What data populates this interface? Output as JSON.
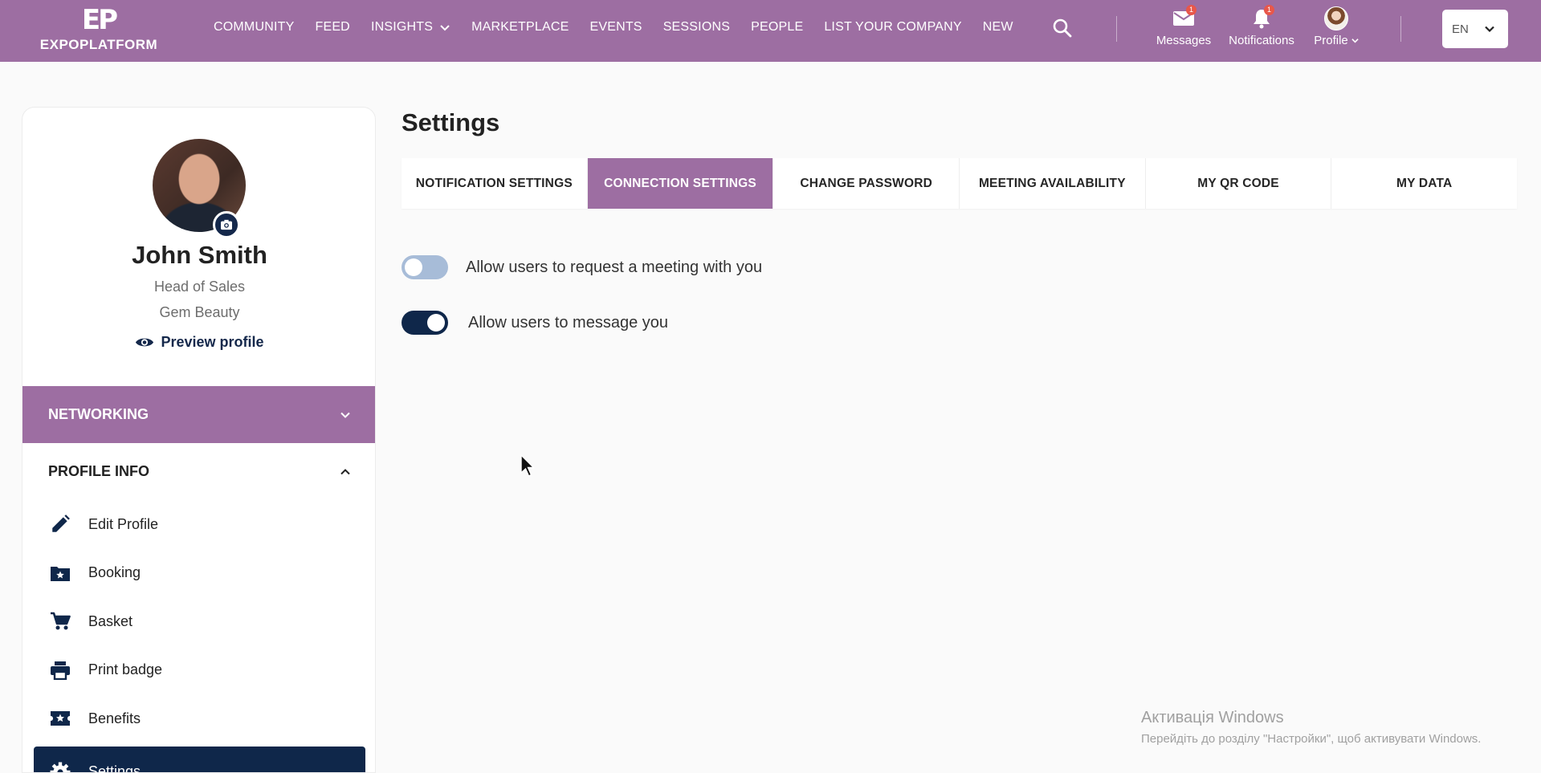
{
  "brand": {
    "mark": "EP",
    "name": "EXPOPLATFORM"
  },
  "nav": [
    {
      "label": "COMMUNITY"
    },
    {
      "label": "FEED"
    },
    {
      "label": "INSIGHTS",
      "has_dropdown": true
    },
    {
      "label": "MARKETPLACE"
    },
    {
      "label": "EVENTS"
    },
    {
      "label": "SESSIONS"
    },
    {
      "label": "PEOPLE"
    },
    {
      "label": "LIST YOUR COMPANY"
    },
    {
      "label": "NEW"
    }
  ],
  "top_actions": {
    "messages": {
      "label": "Messages",
      "badge": "1",
      "icon": "mail-icon"
    },
    "notifications": {
      "label": "Notifications",
      "badge": "1",
      "icon": "bell-icon"
    },
    "profile": {
      "label": "Profile",
      "icon": "avatar"
    }
  },
  "language": {
    "selected": "EN"
  },
  "profile": {
    "name": "John Smith",
    "role": "Head of Sales",
    "company": "Gem Beauty",
    "preview_label": "Preview profile"
  },
  "sidebar": {
    "networking_label": "NETWORKING",
    "profile_info_label": "PROFILE INFO",
    "items": [
      {
        "label": "Edit Profile",
        "icon": "pencil-icon"
      },
      {
        "label": "Booking",
        "icon": "folder-star-icon"
      },
      {
        "label": "Basket",
        "icon": "cart-icon"
      },
      {
        "label": "Print badge",
        "icon": "printer-icon"
      },
      {
        "label": "Benefits",
        "icon": "ticket-star-icon"
      },
      {
        "label": "Settings",
        "icon": "gear-icon",
        "active": true
      }
    ]
  },
  "main": {
    "title": "Settings",
    "tabs": [
      {
        "label": "NOTIFICATION SETTINGS"
      },
      {
        "label": "CONNECTION SETTINGS",
        "active": true
      },
      {
        "label": "CHANGE PASSWORD"
      },
      {
        "label": "MEETING AVAILABILITY"
      },
      {
        "label": "MY QR CODE"
      },
      {
        "label": "MY DATA"
      }
    ],
    "toggles": [
      {
        "label": "Allow users to request a meeting with you",
        "on": false
      },
      {
        "label": "Allow users to message you",
        "on": true
      }
    ]
  },
  "windows_watermark": {
    "line1": "Активація Windows",
    "line2": "Перейдіть до розділу \"Настройки\", щоб активувати Windows."
  },
  "colors": {
    "brand_purple": "#9d6ea2",
    "navy": "#0f274a",
    "toggle_off": "#a7bcd8",
    "badge_red": "#e8574a"
  }
}
